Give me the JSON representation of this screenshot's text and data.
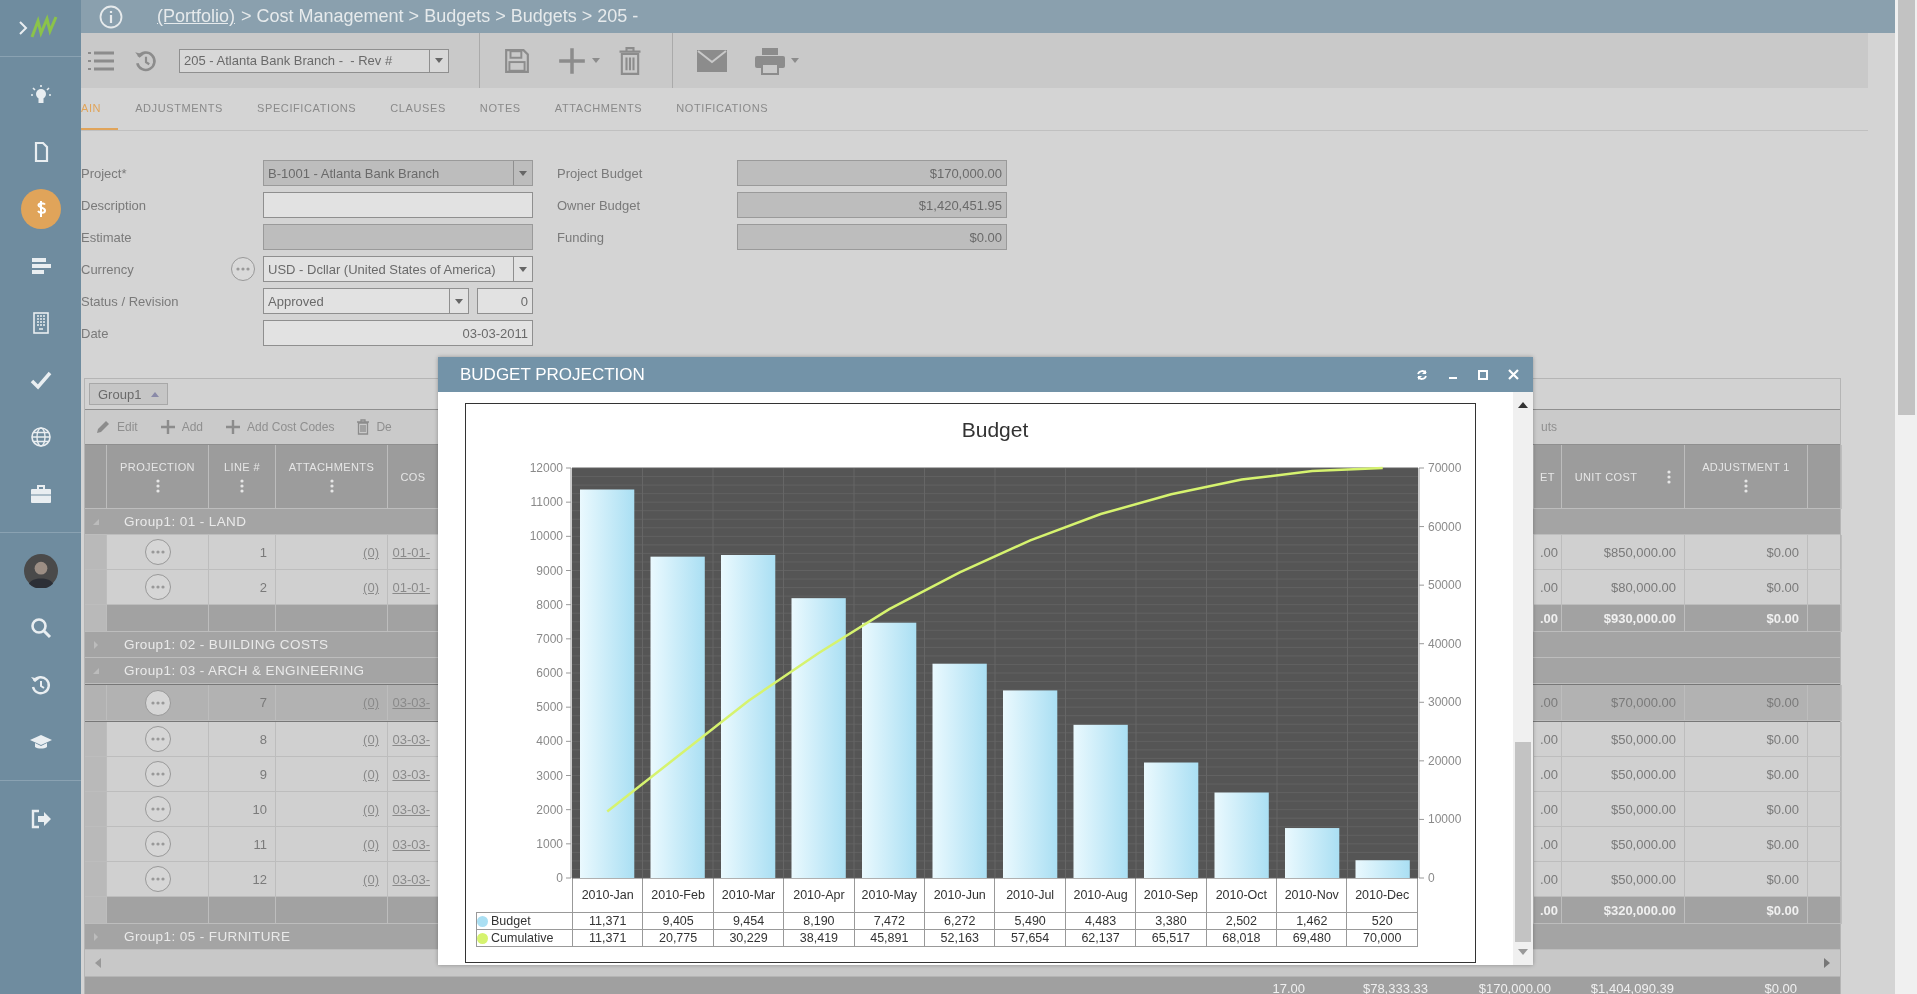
{
  "breadcrumb": {
    "link": "(Portfolio)",
    "trail": "> Cost Management > Budgets > Budgets > 205 -"
  },
  "sidebar": {
    "groups": [
      [
        {
          "kind": "bulb",
          "selected": false
        },
        {
          "kind": "document",
          "selected": false
        },
        {
          "kind": "dollar",
          "selected": true
        },
        {
          "kind": "bars",
          "selected": false
        },
        {
          "kind": "building",
          "selected": false
        },
        {
          "kind": "check",
          "selected": false
        },
        {
          "kind": "globe",
          "selected": false
        },
        {
          "kind": "briefcase",
          "selected": false
        }
      ],
      [
        {
          "kind": "avatar",
          "selected": false
        },
        {
          "kind": "search",
          "selected": false
        },
        {
          "kind": "history",
          "selected": false
        },
        {
          "kind": "cap",
          "selected": false
        }
      ],
      [
        {
          "kind": "exit",
          "selected": false
        }
      ]
    ]
  },
  "toolbar": {
    "record": "205 - Atlanta Bank Branch -  - Rev #"
  },
  "tabs": [
    {
      "label": "AIN",
      "selected": true
    },
    {
      "label": "ADJUSTMENTS",
      "selected": false
    },
    {
      "label": "SPECIFICATIONS",
      "selected": false
    },
    {
      "label": "CLAUSES",
      "selected": false
    },
    {
      "label": "NOTES",
      "selected": false
    },
    {
      "label": "ATTACHMENTS",
      "selected": false
    },
    {
      "label": "NOTIFICATIONS",
      "selected": false
    }
  ],
  "form": {
    "left": [
      {
        "label": "Project*",
        "kind": "select",
        "value": "B-1001 - Atlanta Bank Branch",
        "disabled": true
      },
      {
        "label": "Description",
        "kind": "text",
        "disabled": false
      },
      {
        "label": "Estimate",
        "kind": "text",
        "disabled": true
      },
      {
        "label": "Currency",
        "kind": "lookup_select",
        "value": "USD - Dcllar (United States of America)",
        "disabled": false
      },
      {
        "label": "Status / Revision",
        "kind": "select_number",
        "value": "Approved",
        "number": "0",
        "disabled": false
      },
      {
        "label": "Date",
        "kind": "date",
        "value": "03-03-2011",
        "disabled": false
      }
    ],
    "right": [
      {
        "label": "Project Budget",
        "kind": "amount",
        "value": "$170,000.00",
        "disabled": true
      },
      {
        "label": "Owner Budget",
        "kind": "amount",
        "value": "$1,420,451.95",
        "disabled": true
      },
      {
        "label": "Funding",
        "kind": "amount",
        "value": "$0.00",
        "disabled": true
      }
    ]
  },
  "grid": {
    "group_by": "Group1",
    "tools": [
      {
        "kind": "edit",
        "label": "Edit"
      },
      {
        "kind": "add",
        "label": "Add"
      },
      {
        "kind": "add",
        "label": "Add Cost Codes"
      },
      {
        "kind": "delete",
        "label": "De"
      }
    ],
    "tools_right": "uts",
    "columns": {
      "left": [
        {
          "label": "PROJECTION",
          "menu": true
        },
        {
          "label": "LINE #",
          "menu": true
        },
        {
          "label": "ATTACHMENTS",
          "menu": true
        },
        {
          "label": "COS",
          "menu": false
        }
      ],
      "right": [
        {
          "label": "ET",
          "menu": false
        },
        {
          "label": "UNIT COST",
          "menu": true
        },
        {
          "label": "ADJUSTMENT 1",
          "menu": true
        }
      ]
    },
    "rows": [
      {
        "kind": "group",
        "label": "Group1: 01 - LAND",
        "expanded": true
      },
      {
        "kind": "item",
        "line": "1",
        "attachments": "(0)",
        "cost_code": "01-01-",
        "col_et": ".00",
        "unit_cost": "$850,000.00",
        "adjustment": "$0.00",
        "selected": false
      },
      {
        "kind": "item",
        "line": "2",
        "attachments": "(0)",
        "cost_code": "01-01-",
        "col_et": ".00",
        "unit_cost": "$80,000.00",
        "adjustment": "$0.00",
        "selected": false
      },
      {
        "kind": "subtotal",
        "col_et": ".00",
        "unit_cost": "$930,000.00",
        "adjustment": "$0.00"
      },
      {
        "kind": "group",
        "label": "Group1: 02 - BUILDING COSTS",
        "expanded": false
      },
      {
        "kind": "group",
        "label": "Group1: 03 - ARCH & ENGINEERING",
        "expanded": true
      },
      {
        "kind": "item",
        "line": "7",
        "attachments": "(0)",
        "cost_code": "03-03-",
        "col_et": ".00",
        "unit_cost": "$70,000.00",
        "adjustment": "$0.00",
        "selected": true
      },
      {
        "kind": "item",
        "line": "8",
        "attachments": "(0)",
        "cost_code": "03-03-",
        "col_et": ".00",
        "unit_cost": "$50,000.00",
        "adjustment": "$0.00",
        "selected": false
      },
      {
        "kind": "item",
        "line": "9",
        "attachments": "(0)",
        "cost_code": "03-03-",
        "col_et": ".00",
        "unit_cost": "$50,000.00",
        "adjustment": "$0.00",
        "selected": false
      },
      {
        "kind": "item",
        "line": "10",
        "attachments": "(0)",
        "cost_code": "03-03-",
        "col_et": ".00",
        "unit_cost": "$50,000.00",
        "adjustment": "$0.00",
        "selected": false
      },
      {
        "kind": "item",
        "line": "11",
        "attachments": "(0)",
        "cost_code": "03-03-",
        "col_et": ".00",
        "unit_cost": "$50,000.00",
        "adjustment": "$0.00",
        "selected": false
      },
      {
        "kind": "item",
        "line": "12",
        "attachments": "(0)",
        "cost_code": "03-03-",
        "col_et": ".00",
        "unit_cost": "$50,000.00",
        "adjustment": "$0.00",
        "selected": false
      },
      {
        "kind": "subtotal",
        "col_et": ".00",
        "unit_cost": "$320,000.00",
        "adjustment": "$0.00"
      },
      {
        "kind": "group",
        "label": "Group1: 05 - FURNITURE",
        "expanded": false
      }
    ],
    "totals": [
      "17.00",
      "$78,333.33",
      "$170,000.00",
      "$1,404,090.39",
      "$0.00"
    ]
  },
  "modal": {
    "title": "BUDGET PROJECTION",
    "chart_data": {
      "type": "bar",
      "title": "Budget",
      "categories": [
        "2010-Jan",
        "2010-Feb",
        "2010-Mar",
        "2010-Apr",
        "2010-May",
        "2010-Jun",
        "2010-Jul",
        "2010-Aug",
        "2010-Sep",
        "2010-Oct",
        "2010-Nov",
        "2010-Dec"
      ],
      "series": [
        {
          "name": "Budget",
          "color": "#aadff3",
          "type": "bar",
          "values": [
            11371,
            9405,
            9454,
            8190,
            7472,
            6272,
            5490,
            4483,
            3380,
            2502,
            1462,
            520
          ]
        },
        {
          "name": "Cumulative",
          "color": "#d6f36f",
          "type": "line",
          "axis": "y2",
          "values": [
            11371,
            20775,
            30229,
            38419,
            45891,
            52163,
            57654,
            62137,
            65517,
            68018,
            69480,
            70000
          ]
        }
      ],
      "ylim": [
        0,
        12000
      ],
      "yticks": [
        0,
        1000,
        2000,
        3000,
        4000,
        5000,
        6000,
        7000,
        8000,
        9000,
        10000,
        11000,
        12000
      ],
      "y2lim": [
        0,
        70000
      ],
      "y2ticks": [
        0,
        10000,
        20000,
        30000,
        40000,
        50000,
        60000,
        70000
      ],
      "grid": true,
      "legend": "bottom"
    },
    "data_table": [
      {
        "cells": [
          "11,371",
          "9,405",
          "9,454",
          "8,190",
          "7,472",
          "6,272",
          "5,490",
          "4,483",
          "3,380",
          "2,502",
          "1,462",
          "520"
        ]
      },
      {
        "cells": [
          "11,371",
          "20,775",
          "30,229",
          "38,419",
          "45,891",
          "52,163",
          "57,654",
          "62,137",
          "65,517",
          "68,018",
          "69,480",
          "70,000"
        ]
      }
    ]
  }
}
